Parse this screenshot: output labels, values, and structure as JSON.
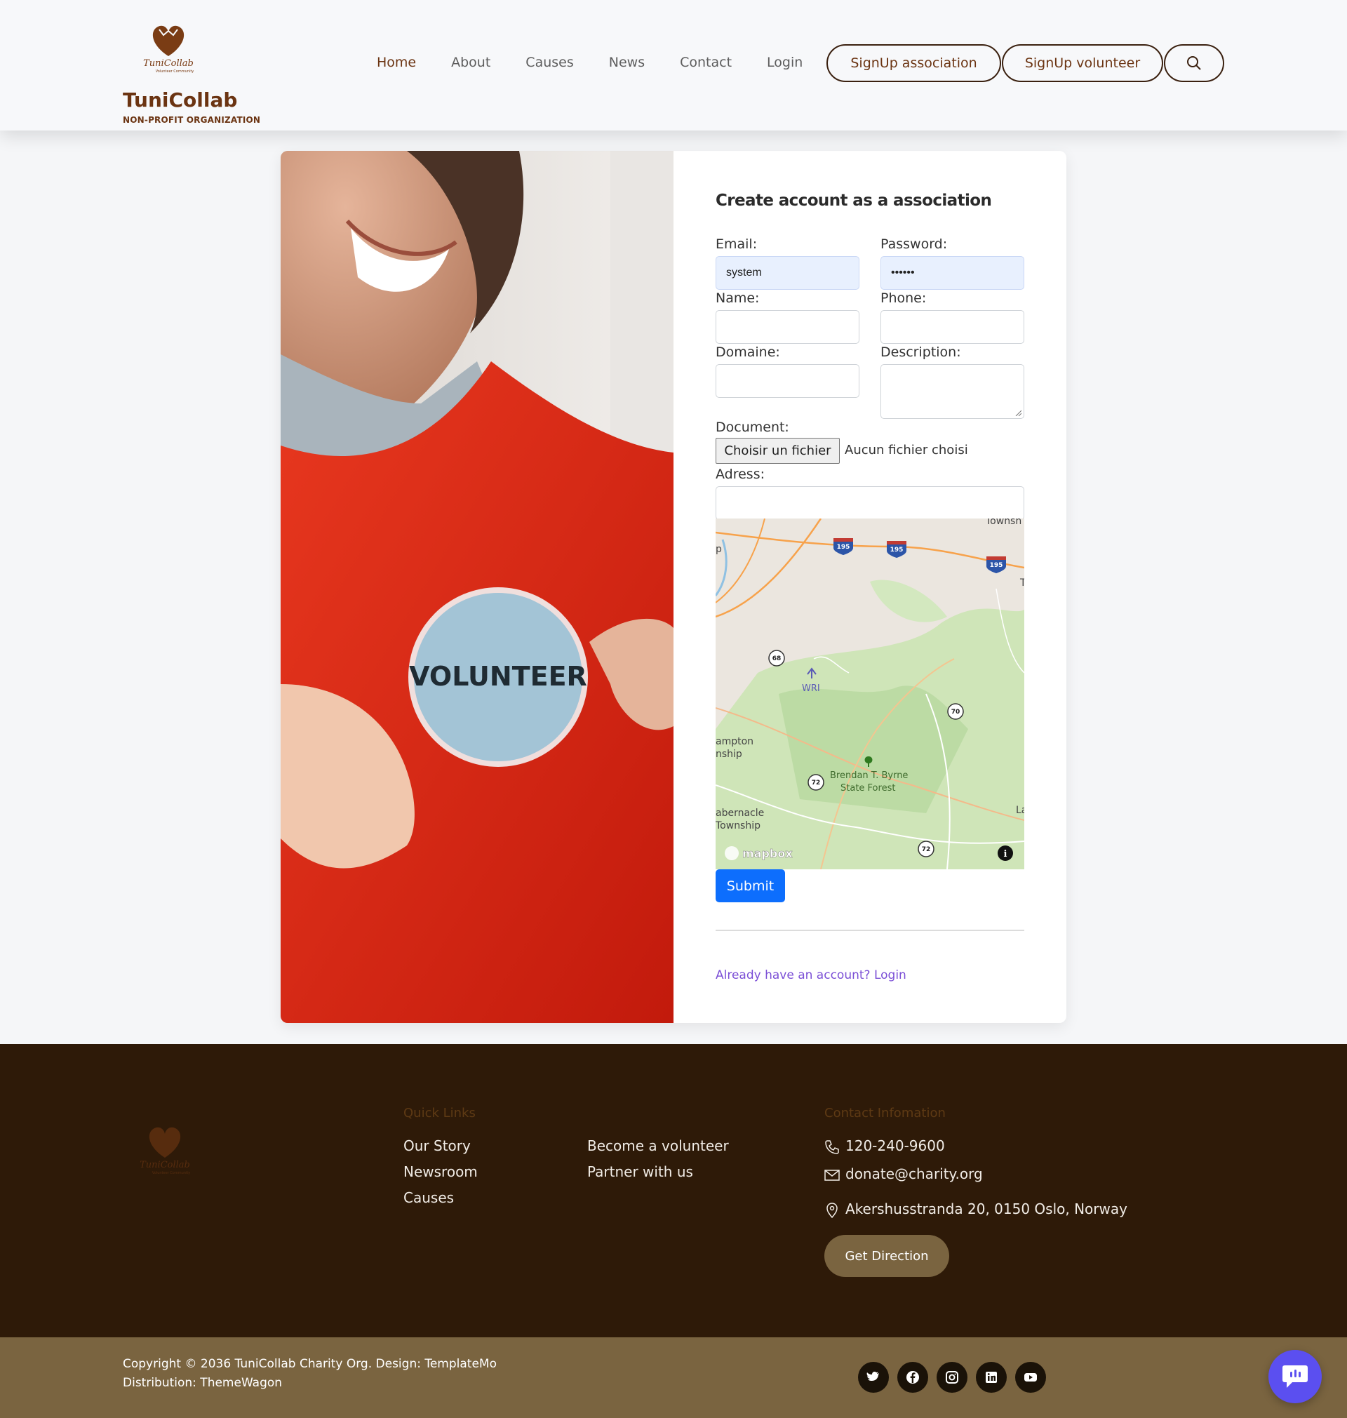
{
  "header": {
    "brand": "TuniCollab",
    "brand_sub": "NON-PROFIT ORGANIZATION",
    "logo_text": "TuniCollab",
    "logo_tagline": "Volunteer Community",
    "nav": [
      "Home",
      "About",
      "Causes",
      "News",
      "Contact",
      "Login"
    ],
    "signup_association": "SignUp association",
    "signup_volunteer": "SignUp volunteer",
    "search_icon": "search-icon"
  },
  "photo": {
    "badge_text": "VOLUNTEER"
  },
  "form": {
    "title": "Create account as a association",
    "email_label": "Email:",
    "email_value": "system",
    "password_label": "Password:",
    "password_value": "••••••",
    "name_label": "Name:",
    "phone_label": "Phone:",
    "domaine_label": "Domaine:",
    "description_label": "Description:",
    "document_label": "Document:",
    "file_button": "Choisir un fichier",
    "file_status": "Aucun fichier choisi",
    "address_label": "Adress:",
    "submit": "Submit",
    "login_link": "Already have an account? Login"
  },
  "map": {
    "labels": [
      "Townsh",
      "p",
      "T",
      "WRI",
      "ampton",
      "nship",
      "Brendan T. Byrne",
      "State Forest",
      "abernacle",
      "Township",
      "La"
    ],
    "shields": [
      "195",
      "195",
      "195",
      "68",
      "70",
      "72",
      "72"
    ],
    "attribution": "mapbox"
  },
  "footer": {
    "quick_links_title": "Quick Links",
    "links_col1": [
      "Our Story",
      "Newsroom",
      "Causes"
    ],
    "links_col2": [
      "Become a volunteer",
      "Partner with us"
    ],
    "contact_title": "Contact Infomation",
    "phone": "120-240-9600",
    "email": "donate@charity.org",
    "address": "Akershusstranda 20, 0150 Oslo, Norway",
    "direction_button": "Get Direction",
    "copyright_line1": "Copyright © 2036 TuniCollab Charity Org. Design: TemplateMo",
    "copyright_line2": "Distribution: ThemeWagon",
    "social": [
      "twitter-icon",
      "facebook-icon",
      "instagram-icon",
      "linkedin-icon",
      "youtube-icon"
    ]
  },
  "colors": {
    "brand": "#6b3412",
    "footer_bg": "#2e1a08",
    "bottom_bg": "#7a6440",
    "submit": "#0d6efd",
    "link": "#7b4fd6",
    "chat": "#5b4ff0"
  }
}
